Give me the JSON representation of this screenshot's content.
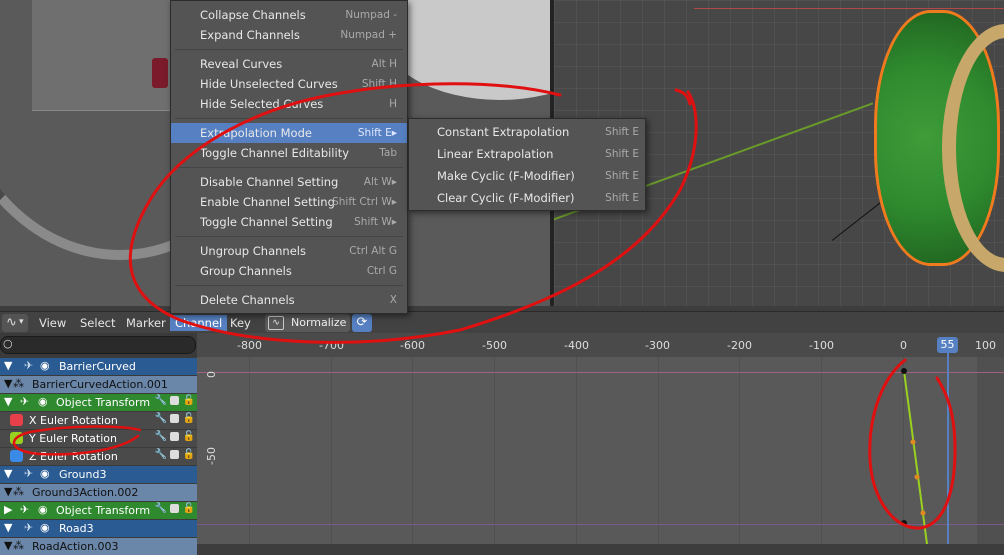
{
  "header": {
    "menus": [
      "View",
      "Select",
      "Marker",
      "Channel",
      "Key"
    ],
    "active_menu": "Channel",
    "normalize_label": "Normalize"
  },
  "channel_menu": {
    "items": [
      {
        "label": "Collapse Channels",
        "shortcut": "Numpad -"
      },
      {
        "label": "Expand Channels",
        "shortcut": "Numpad +"
      },
      {
        "label": "Reveal Curves",
        "shortcut": "Alt H"
      },
      {
        "label": "Hide Unselected Curves",
        "shortcut": "Shift H"
      },
      {
        "label": "Hide Selected Curves",
        "shortcut": "H"
      },
      {
        "label": "Extrapolation Mode",
        "shortcut": "Shift E▸"
      },
      {
        "label": "Toggle Channel Editability",
        "shortcut": "Tab"
      },
      {
        "label": "Disable Channel Setting",
        "shortcut": "Alt W▸"
      },
      {
        "label": "Enable Channel Setting",
        "shortcut": "Shift Ctrl W▸"
      },
      {
        "label": "Toggle Channel Setting",
        "shortcut": "Shift W▸"
      },
      {
        "label": "Ungroup Channels",
        "shortcut": "Ctrl Alt G"
      },
      {
        "label": "Group Channels",
        "shortcut": "Ctrl G"
      },
      {
        "label": "Delete Channels",
        "shortcut": "X"
      }
    ]
  },
  "extrapolation_submenu": {
    "items": [
      {
        "label": "Constant Extrapolation",
        "shortcut": "Shift E"
      },
      {
        "label": "Linear Extrapolation",
        "shortcut": "Shift E"
      },
      {
        "label": "Make Cyclic (F-Modifier)",
        "shortcut": "Shift E"
      },
      {
        "label": "Clear Cyclic (F-Modifier)",
        "shortcut": "Shift E"
      }
    ]
  },
  "channels": [
    {
      "label": "BarrierCurved"
    },
    {
      "label": "BarrierCurvedAction.001"
    },
    {
      "label": "Object Transform"
    },
    {
      "label": "X Euler Rotation"
    },
    {
      "label": "Y Euler Rotation"
    },
    {
      "label": "Z Euler Rotation"
    },
    {
      "label": "Ground3"
    },
    {
      "label": "Ground3Action.002"
    },
    {
      "label": "Object Transform"
    },
    {
      "label": "Road3"
    },
    {
      "label": "RoadAction.003"
    }
  ],
  "graph": {
    "ruler_ticks": [
      "-800",
      "-700",
      "-600",
      "-500",
      "-400",
      "-300",
      "-200",
      "-100",
      "0",
      "100"
    ],
    "current_frame": "55",
    "value_labels": [
      "0",
      "-50"
    ]
  },
  "colors": {
    "accent": "#5680c2",
    "object_row": "#2a5b93",
    "group_row": "#2f8a2f",
    "x_curve": "#e8404a",
    "y_curve": "#9ad020",
    "z_curve": "#3a8ae8",
    "annotation": "#e01010"
  },
  "icons": [
    "editor-type-icon",
    "search-icon",
    "eye-icon",
    "triangle-icon",
    "wrench-icon",
    "checkbox-icon",
    "lock-icon",
    "sync-icon"
  ]
}
